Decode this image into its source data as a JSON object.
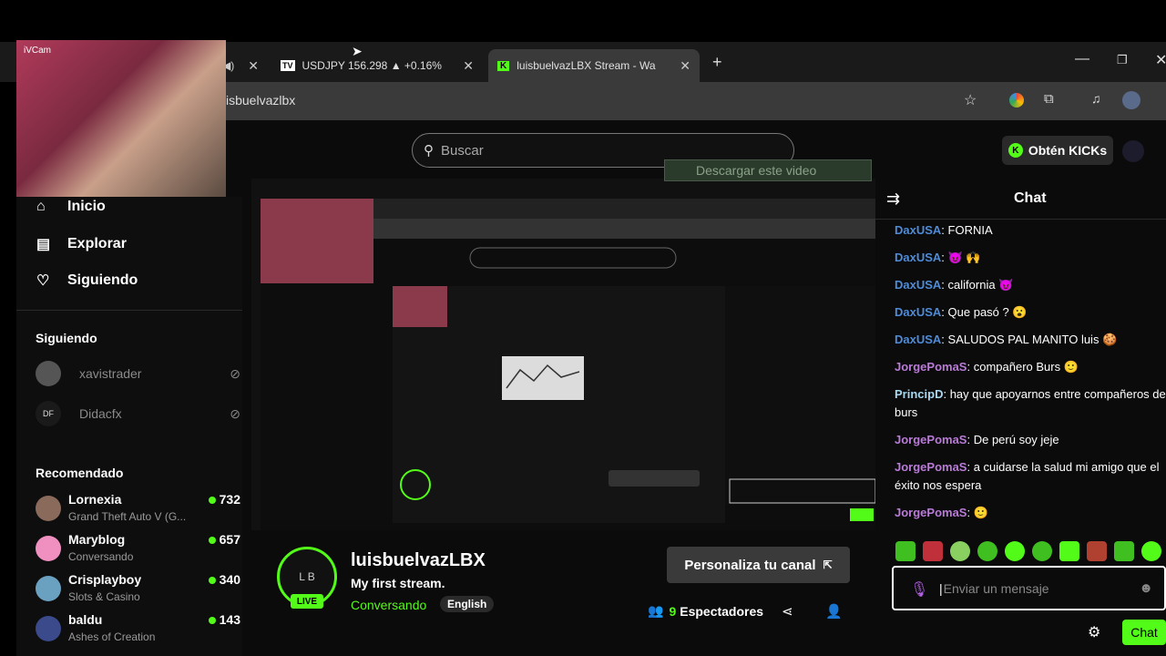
{
  "browser": {
    "tabs": [
      {
        "title": "USDJPY 156.298 ▲ +0.16%"
      },
      {
        "title": "luisbuelvazLBX Stream - Wa"
      }
    ],
    "address": "isbuelvazlbx"
  },
  "camera_label": "iVCam",
  "header": {
    "search_placeholder": "Buscar",
    "kicks_label": "Obtén KICKs",
    "download_banner": "Descargar este video"
  },
  "sidebar": {
    "nav": [
      {
        "label": "Inicio",
        "icon": "home-icon"
      },
      {
        "label": "Explorar",
        "icon": "browse-icon"
      },
      {
        "label": "Siguiendo",
        "icon": "heart-icon"
      }
    ],
    "following_title": "Siguiendo",
    "following": [
      {
        "name": "xavistrader"
      },
      {
        "name": "Didacfx",
        "initials": "DF"
      }
    ],
    "recommended_title": "Recomendado",
    "recommended": [
      {
        "name": "Lornexia",
        "category": "Grand Theft Auto V (G...",
        "viewers": "732"
      },
      {
        "name": "Maryblog",
        "category": "Conversando",
        "viewers": "657"
      },
      {
        "name": "Crisplayboy",
        "category": "Slots & Casino",
        "viewers": "340"
      },
      {
        "name": "baldu",
        "category": "Ashes of Creation",
        "viewers": "143"
      }
    ]
  },
  "chat": {
    "title": "Chat",
    "messages": [
      {
        "user": "DaxUSA",
        "text": "FORNIA"
      },
      {
        "user": "DaxUSA",
        "text": "😈 🙌"
      },
      {
        "user": "DaxUSA",
        "text": "california 😈"
      },
      {
        "user": "DaxUSA",
        "text": "Que pasó ? 😮"
      },
      {
        "user": "DaxUSA",
        "text": "SALUDOS PAL MANITO luis 🍪"
      },
      {
        "user": "JorgePomaS",
        "text": "compañero Burs 🙂"
      },
      {
        "user": "PrincipD",
        "text": "hay que apoyarnos entre compañeros de burs"
      },
      {
        "user": "JorgePomaS",
        "text": "De perú soy jeje"
      },
      {
        "user": "JorgePomaS",
        "text": "a cuidarse la salud mi amigo que el éxito nos espera"
      },
      {
        "user": "JorgePomaS",
        "text": "🙂"
      }
    ],
    "input_placeholder": "Enviar un mensaje",
    "send_label": "Chat"
  },
  "channel": {
    "name": "luisbuelvazLBX",
    "stream_title": "My first stream.",
    "category": "Conversando",
    "language": "English",
    "live_label": "LIVE",
    "avatar_initials": "L B",
    "customize_label": "Personaliza tu canal",
    "viewers_count": "9",
    "viewers_label": "Espectadores"
  },
  "colors": {
    "accent": "#53fc18",
    "dax": "#4e8bd8",
    "jorge": "#b97ad8",
    "principd": "#a8d8f0"
  }
}
